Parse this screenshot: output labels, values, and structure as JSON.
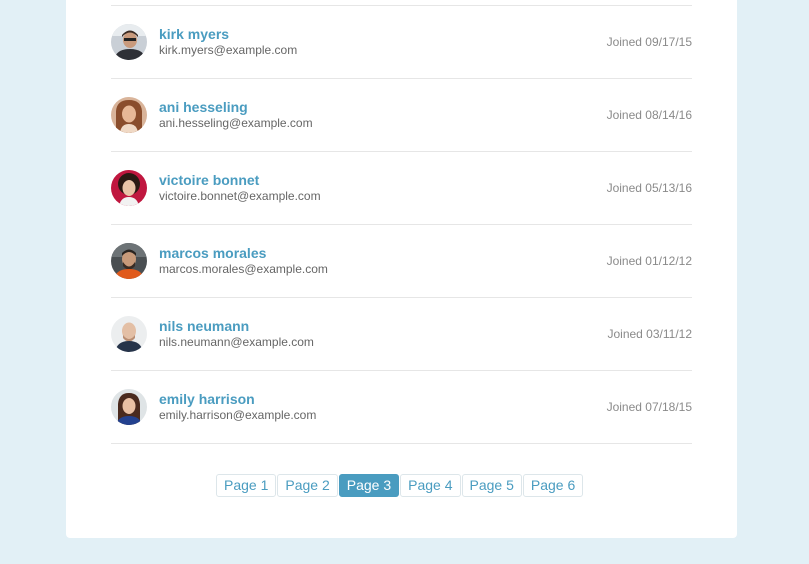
{
  "users": [
    {
      "name": "kirk myers",
      "email": "kirk.myers@example.com",
      "joined": "Joined 09/17/15"
    },
    {
      "name": "ani hesseling",
      "email": "ani.hesseling@example.com",
      "joined": "Joined 08/14/16"
    },
    {
      "name": "victoire bonnet",
      "email": "victoire.bonnet@example.com",
      "joined": "Joined 05/13/16"
    },
    {
      "name": "marcos morales",
      "email": "marcos.morales@example.com",
      "joined": "Joined 01/12/12"
    },
    {
      "name": "nils neumann",
      "email": "nils.neumann@example.com",
      "joined": "Joined 03/11/12"
    },
    {
      "name": "emily harrison",
      "email": "emily.harrison@example.com",
      "joined": "Joined 07/18/15"
    }
  ],
  "pagination": {
    "pages": [
      "Page 1",
      "Page 2",
      "Page 3",
      "Page 4",
      "Page 5",
      "Page 6"
    ],
    "active": "Page 3"
  },
  "colors": {
    "background": "#e2f0f6",
    "accent": "#4a9cc0",
    "name_text": "#4a9cc0",
    "email_text": "#666666",
    "joined_text": "#8a8a8a"
  }
}
